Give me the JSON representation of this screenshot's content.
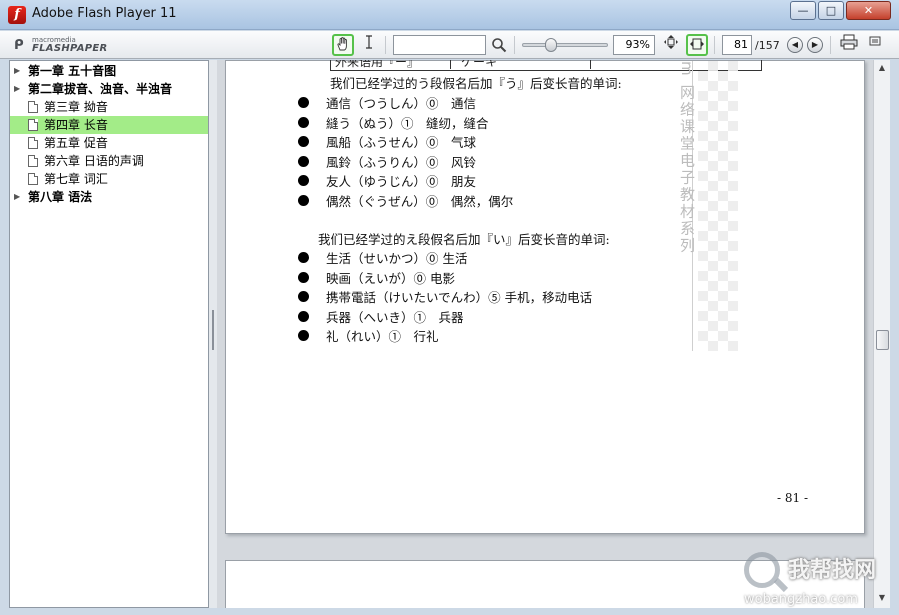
{
  "window": {
    "title": "Adobe Flash Player 11",
    "min_label": "—",
    "max_label": "□",
    "close_label": "✕"
  },
  "toolbar": {
    "brand_small": "macromedia",
    "brand_big": "FLASHPAPER",
    "search_value": "",
    "zoom_value": "93%",
    "zoom_slider_fraction": 0.34,
    "page_current": "81",
    "page_total": "/157"
  },
  "toc": [
    {
      "label": "第一章 五十音图",
      "level": 0,
      "bold": true,
      "expandable": true,
      "selected": false
    },
    {
      "label": "第二章拔音、浊音、半浊音",
      "level": 0,
      "bold": true,
      "expandable": true,
      "selected": false
    },
    {
      "label": "第三章 拗音",
      "level": 1,
      "bold": false,
      "expandable": false,
      "selected": false
    },
    {
      "label": "第四章 长音",
      "level": 1,
      "bold": false,
      "expandable": false,
      "selected": true
    },
    {
      "label": "第五章 促音",
      "level": 1,
      "bold": false,
      "expandable": false,
      "selected": false
    },
    {
      "label": "第六章 日语的声调",
      "level": 1,
      "bold": false,
      "expandable": false,
      "selected": false
    },
    {
      "label": "第七章 词汇",
      "level": 1,
      "bold": false,
      "expandable": false,
      "selected": false
    },
    {
      "label": "第八章 语法",
      "level": 0,
      "bold": true,
      "expandable": true,
      "selected": false
    }
  ],
  "page": {
    "table_cell_1": "外来语用『ー』",
    "table_cell_2": "ケーキ",
    "section1_heading": "我们已经学过的う段假名后加『う』后变长音的单词:",
    "section1_items": [
      "通信（つうしん）⓪　通信",
      "縫う（ぬう）①　缝纫，缝合",
      "風船（ふうせん）⓪　气球",
      "風鈴（ふうりん）⓪　风铃",
      "友人（ゆうじん）⓪　朋友",
      "偶然（ぐうぜん）⓪　偶然，偶尔"
    ],
    "section2_heading": "我们已经学过的え段假名后加『い』后变长音的单词:",
    "section2_items": [
      "生活（せいかつ）⓪ 生活",
      "映画（えいが）⓪ 电影",
      "携帯電話（けいたいでんわ）⑤ 手机，移动电话",
      "兵器（へいき）①　兵器",
      "礼（れい）①　行礼"
    ],
    "side_watermark": "m 网络课堂电子教材系列",
    "page_number": "- 81 -"
  },
  "site_watermark": {
    "cn": "我帮找网",
    "en": "wobangzhao.com"
  }
}
